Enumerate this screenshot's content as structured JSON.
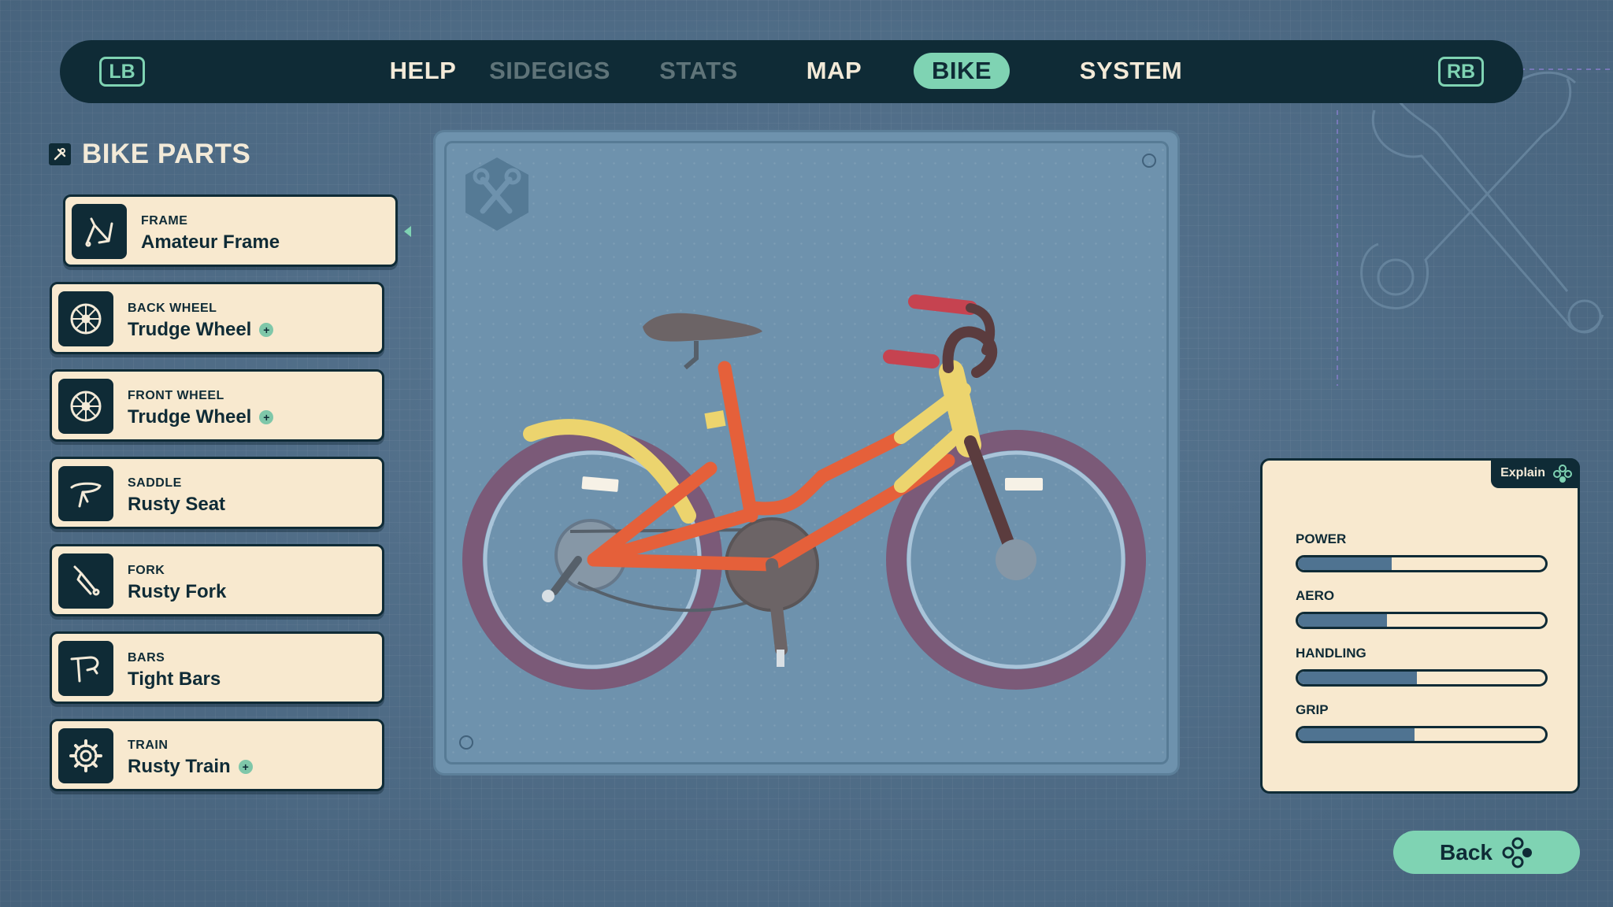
{
  "nav": {
    "left_shoulder": "LB",
    "right_shoulder": "RB",
    "tabs": [
      {
        "label": "HELP",
        "state": "normal"
      },
      {
        "label": "SIDEGIGS",
        "state": "dim"
      },
      {
        "label": "STATS",
        "state": "dim"
      },
      {
        "label": "MAP",
        "state": "normal"
      },
      {
        "label": "BIKE",
        "state": "active"
      },
      {
        "label": "SYSTEM",
        "state": "normal"
      }
    ]
  },
  "panel": {
    "title": "BIKE PARTS",
    "parts": [
      {
        "type": "FRAME",
        "name": "Amateur Frame",
        "icon": "frame-icon",
        "upgrade": false,
        "selected": true
      },
      {
        "type": "BACK WHEEL",
        "name": "Trudge Wheel",
        "icon": "wheel-icon",
        "upgrade": true,
        "selected": false
      },
      {
        "type": "FRONT WHEEL",
        "name": "Trudge Wheel",
        "icon": "wheel-icon",
        "upgrade": true,
        "selected": false
      },
      {
        "type": "SADDLE",
        "name": "Rusty Seat",
        "icon": "saddle-icon",
        "upgrade": false,
        "selected": false
      },
      {
        "type": "FORK",
        "name": "Rusty Fork",
        "icon": "fork-icon",
        "upgrade": false,
        "selected": false
      },
      {
        "type": "BARS",
        "name": "Tight Bars",
        "icon": "bars-icon",
        "upgrade": false,
        "selected": false
      },
      {
        "type": "TRAIN",
        "name": "Rusty Train",
        "icon": "gear-icon",
        "upgrade": true,
        "selected": false
      }
    ]
  },
  "stats": {
    "explain_label": "Explain",
    "items": [
      {
        "label": "POWER",
        "value": 0.38
      },
      {
        "label": "AERO",
        "value": 0.36
      },
      {
        "label": "HANDLING",
        "value": 0.48
      },
      {
        "label": "GRIP",
        "value": 0.47
      }
    ]
  },
  "footer": {
    "back_label": "Back"
  },
  "colors": {
    "background": "#4f6f8c",
    "navy": "#0f2b36",
    "mint": "#7fd3b3",
    "cream": "#f8e9cf",
    "display": "#6e92ad",
    "frame_orange": "#e5603a",
    "frame_yellow": "#ecd46e",
    "tire_purple": "#7b5a78"
  }
}
